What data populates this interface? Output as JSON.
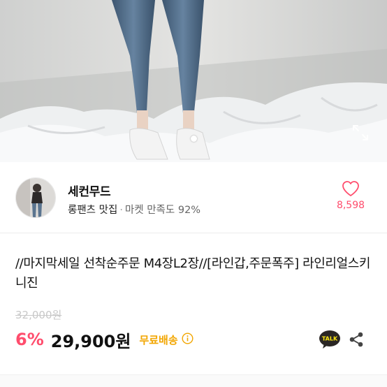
{
  "image": {
    "alt": "",
    "carousel_dots": 1
  },
  "shop": {
    "name": "세컨무드",
    "tag": "롱팬츠 맛집",
    "separator": "·",
    "satisfaction": "마켓 만족도 92%",
    "like_count": "8,598"
  },
  "product": {
    "title": "//마지막세일 선착순주문 M4장L2장//[라인갑,주문폭주] 라인리얼스키니진",
    "original_price": "32,000원",
    "discount": "6%",
    "price": "29,900원",
    "shipping": "무료배송",
    "talk_label": "TALK"
  },
  "colors": {
    "accent_pink": "#ff4d6d",
    "shipping_yellow": "#f2a600",
    "talk_yellow": "#ffe812"
  },
  "icons": [
    "expand-icon",
    "heart-icon",
    "info-icon",
    "kakao-talk-icon",
    "share-icon"
  ]
}
